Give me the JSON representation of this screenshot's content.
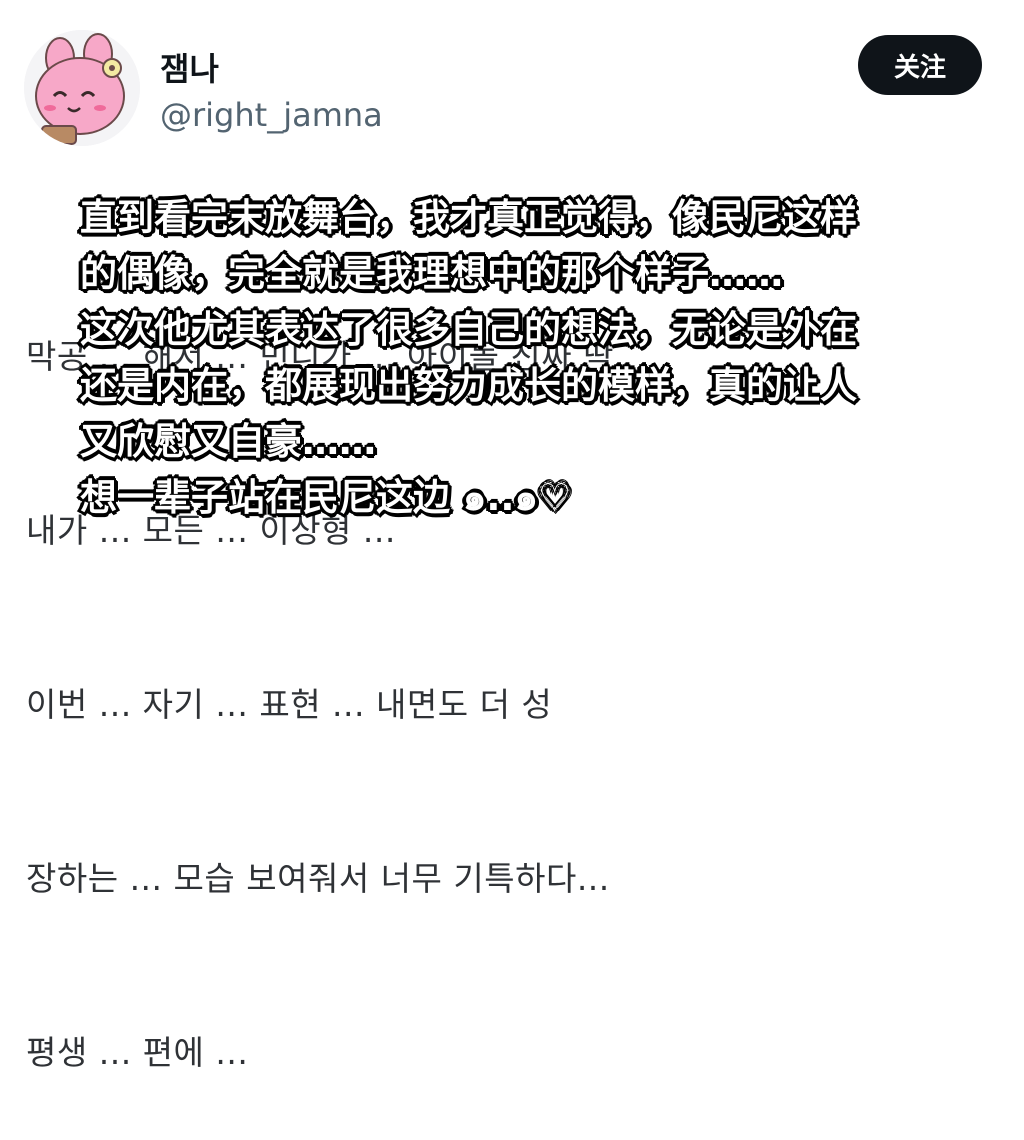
{
  "profile": {
    "display_name": "잼나",
    "handle": "@right_jamna",
    "follow_label": "关注",
    "avatar_icon": "pink-bunny-avatar-icon"
  },
  "tweet": {
    "lines": [
      "막공 ... 해서 ... 민니가 ... 아이돌 진짜 딱",
      "내가 ... 모든 ... 이상형 ...",
      "이번 ... 자기 ... 표현 ... 내면도 더 성",
      "장하는 ... 모습 보여줘서 너무 기특하다...",
      "평생 ... 편에 ..."
    ]
  },
  "overlay": {
    "lines": [
      "直到看完末放舞台，我才真正觉得，像民尼这样",
      "的偶像，完全就是我理想中的那个样子……",
      "这次他尤其表达了很多自己的想法，无论是外在",
      "还是内在，都展现出努力成长的模样，真的让人",
      "又欣慰又自豪……",
      "想一辈子站在民尼这边 ๑..๑♡"
    ]
  }
}
